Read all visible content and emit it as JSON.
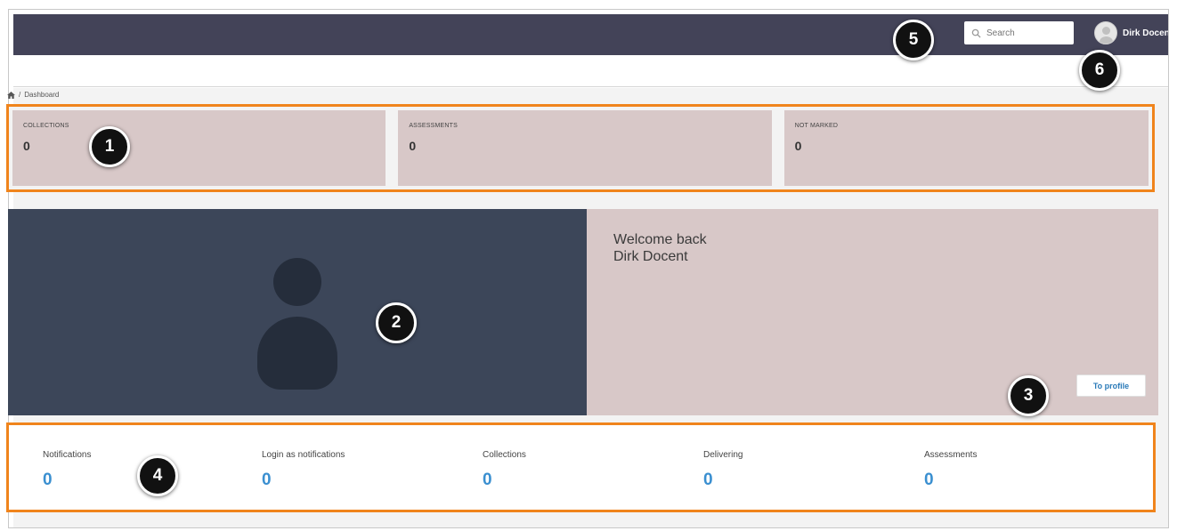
{
  "header": {
    "search_placeholder": "Search",
    "search_icon": "search-icon",
    "user_name": "Dirk Docent",
    "avatar_icon": "user-avatar-icon"
  },
  "breadcrumb": {
    "home_icon": "home-icon",
    "separator": "/",
    "current": "Dashboard"
  },
  "stats": [
    {
      "label": "COLLECTIONS",
      "value": "0"
    },
    {
      "label": "ASSESSMENTS",
      "value": "0"
    },
    {
      "label": "NOT MARKED",
      "value": "0"
    }
  ],
  "profile": {
    "welcome_line1": "Welcome back",
    "welcome_line2": "Dirk Docent",
    "to_profile_label": "To profile",
    "picture_icon": "user-silhouette-icon"
  },
  "summary": [
    {
      "label": "Notifications",
      "value": "0"
    },
    {
      "label": "Login as notifications",
      "value": "0"
    },
    {
      "label": "Collections",
      "value": "0"
    },
    {
      "label": "Delivering",
      "value": "0"
    },
    {
      "label": "Assessments",
      "value": "0"
    }
  ],
  "callouts": [
    "1",
    "2",
    "3",
    "4",
    "5",
    "6"
  ],
  "colors": {
    "topbar": "#434358",
    "highlight": "#f0841c",
    "stat_bg": "#d8c8c8",
    "profile_bg": "#3c4659",
    "link_blue": "#3a8fd0"
  }
}
